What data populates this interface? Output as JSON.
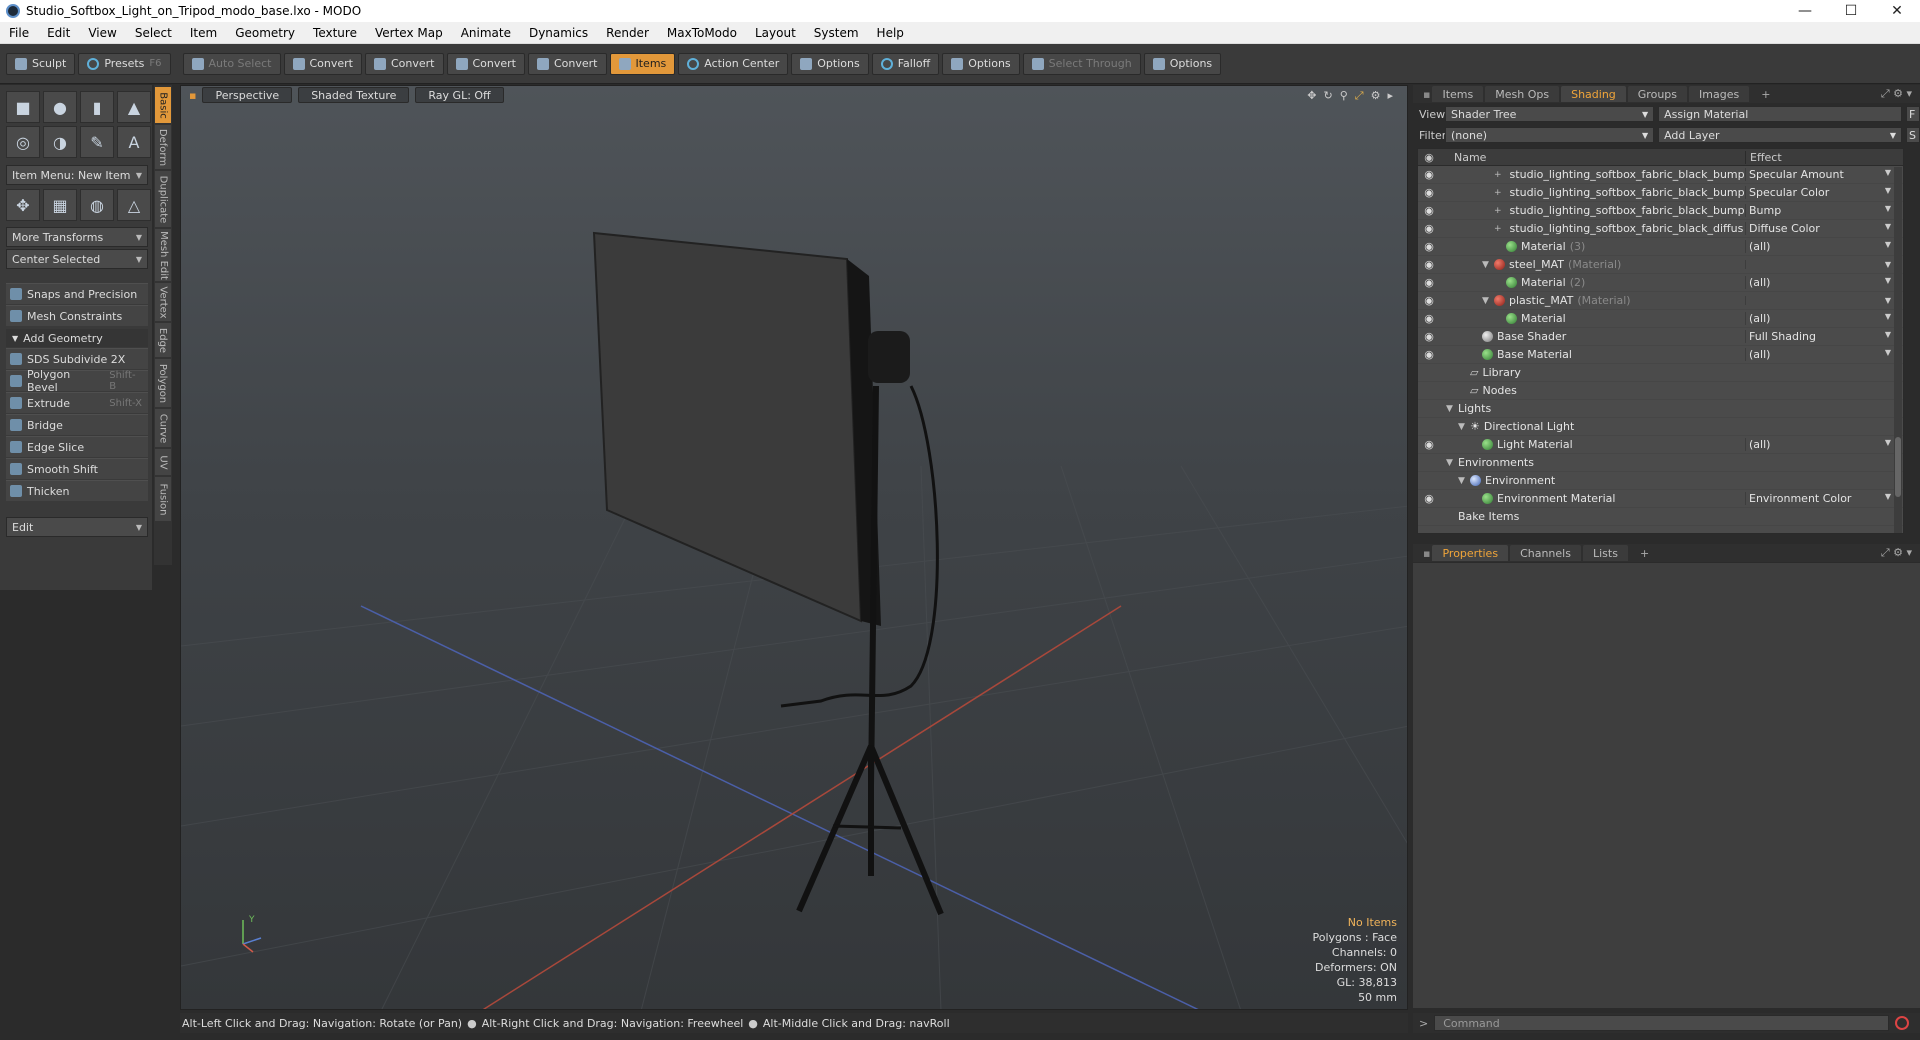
{
  "window": {
    "title": "Studio_Softbox_Light_on_Tripod_modo_base.lxo - MODO",
    "minimize": "—",
    "maximize": "☐",
    "close": "✕"
  },
  "menu": [
    "File",
    "Edit",
    "View",
    "Select",
    "Item",
    "Geometry",
    "Texture",
    "Vertex Map",
    "Animate",
    "Dynamics",
    "Render",
    "MaxToModo",
    "Layout",
    "System",
    "Help"
  ],
  "toolbar": {
    "sculpt": "Sculpt",
    "presets": "Presets",
    "presets_shortcut": "F6",
    "auto_select": "Auto Select",
    "convert1": "Convert",
    "convert2": "Convert",
    "convert3": "Convert",
    "convert4": "Convert",
    "items": "Items",
    "action_center": "Action Center",
    "options1": "Options",
    "falloff": "Falloff",
    "options2": "Options",
    "select_through": "Select Through",
    "options3": "Options"
  },
  "leftpanel": {
    "item_menu": "Item Menu: New Item",
    "more_transforms": "More Transforms",
    "center_selected": "Center Selected",
    "snaps": "Snaps and Precision",
    "mesh_constraints": "Mesh Constraints",
    "add_geometry": "Add Geometry",
    "tools": [
      {
        "label": "SDS Subdivide 2X",
        "shortcut": ""
      },
      {
        "label": "Polygon Bevel",
        "shortcut": "Shift-B"
      },
      {
        "label": "Extrude",
        "shortcut": "Shift-X"
      },
      {
        "label": "Bridge",
        "shortcut": ""
      },
      {
        "label": "Edge Slice",
        "shortcut": ""
      },
      {
        "label": "Smooth Shift",
        "shortcut": ""
      },
      {
        "label": "Thicken",
        "shortcut": ""
      }
    ],
    "edit": "Edit",
    "vtabs": [
      "Basic",
      "Deform",
      "Duplicate",
      "Mesh Edit",
      "Vertex",
      "Edge",
      "Polygon",
      "Curve",
      "UV",
      "Fusion"
    ]
  },
  "viewport": {
    "view_mode": "Perspective",
    "shading": "Shaded Texture",
    "raygl": "Ray GL: Off",
    "stats": {
      "items": "No Items",
      "polygons": "Polygons : Face",
      "channels": "Channels: 0",
      "deformers": "Deformers: ON",
      "gl": "GL: 38,813",
      "focal": "50 mm"
    }
  },
  "statusline": {
    "hint1": "Alt-Left Click and Drag: Navigation: Rotate (or Pan)",
    "hint2": "Alt-Right Click and Drag: Navigation: Freewheel",
    "hint3": "Alt-Middle Click and Drag: navRoll"
  },
  "rightpanel": {
    "tabs": [
      "Items",
      "Mesh Ops",
      "Shading",
      "Groups",
      "Images"
    ],
    "active_tab": "Shading",
    "view_label": "View",
    "view_value": "Shader Tree",
    "assign_material": "Assign Material",
    "filter_label": "Filter",
    "filter_value": "(none)",
    "add_layer": "Add Layer",
    "f_btn": "F",
    "s_btn": "S",
    "col_name": "Name",
    "col_effect": "Effect",
    "rows": [
      {
        "indent": 4,
        "icon": "dark",
        "name": "studio_lighting_softbox_fabric_black_bump …",
        "sub": "",
        "effect": "Specular Amount"
      },
      {
        "indent": 4,
        "icon": "dark",
        "name": "studio_lighting_softbox_fabric_black_bump",
        "sub": "",
        "effect": "Specular Color"
      },
      {
        "indent": 4,
        "icon": "dark",
        "name": "studio_lighting_softbox_fabric_black_bump",
        "sub": "",
        "effect": "Bump"
      },
      {
        "indent": 4,
        "icon": "dark",
        "name": "studio_lighting_softbox_fabric_black_diffus …",
        "sub": "",
        "effect": "Diffuse Color"
      },
      {
        "indent": 4,
        "icon": "green",
        "name": "Material",
        "sub": "(3)",
        "effect": "(all)"
      },
      {
        "indent": 3,
        "icon": "red",
        "name": "steel_MAT",
        "sub": "(Material)",
        "effect": ""
      },
      {
        "indent": 4,
        "icon": "green",
        "name": "Material",
        "sub": "(2)",
        "effect": "(all)"
      },
      {
        "indent": 3,
        "icon": "red",
        "name": "plastic_MAT",
        "sub": "(Material)",
        "effect": ""
      },
      {
        "indent": 4,
        "icon": "green",
        "name": "Material",
        "sub": "",
        "effect": "(all)"
      },
      {
        "indent": 2,
        "icon": "grey",
        "name": "Base Shader",
        "sub": "",
        "effect": "Full Shading"
      },
      {
        "indent": 2,
        "icon": "green",
        "name": "Base Material",
        "sub": "",
        "effect": "(all)"
      },
      {
        "indent": 1,
        "icon": "folder",
        "name": "Library",
        "sub": "",
        "effect": ""
      },
      {
        "indent": 1,
        "icon": "folder",
        "name": "Nodes",
        "sub": "",
        "effect": ""
      },
      {
        "indent": 0,
        "icon": "none",
        "name": "Lights",
        "sub": "",
        "effect": ""
      },
      {
        "indent": 1,
        "icon": "light",
        "name": "Directional Light",
        "sub": "",
        "effect": ""
      },
      {
        "indent": 2,
        "icon": "green",
        "name": "Light Material",
        "sub": "",
        "effect": "(all)"
      },
      {
        "indent": 0,
        "icon": "none",
        "name": "Environments",
        "sub": "",
        "effect": ""
      },
      {
        "indent": 1,
        "icon": "env",
        "name": "Environment",
        "sub": "",
        "effect": ""
      },
      {
        "indent": 2,
        "icon": "green",
        "name": "Environment Material",
        "sub": "",
        "effect": "Environment Color"
      },
      {
        "indent": 0,
        "icon": "none",
        "name": "Bake Items",
        "sub": "",
        "effect": ""
      }
    ],
    "props_tabs": [
      "Properties",
      "Channels",
      "Lists"
    ],
    "active_props_tab": "Properties",
    "command_placeholder": "Command"
  }
}
